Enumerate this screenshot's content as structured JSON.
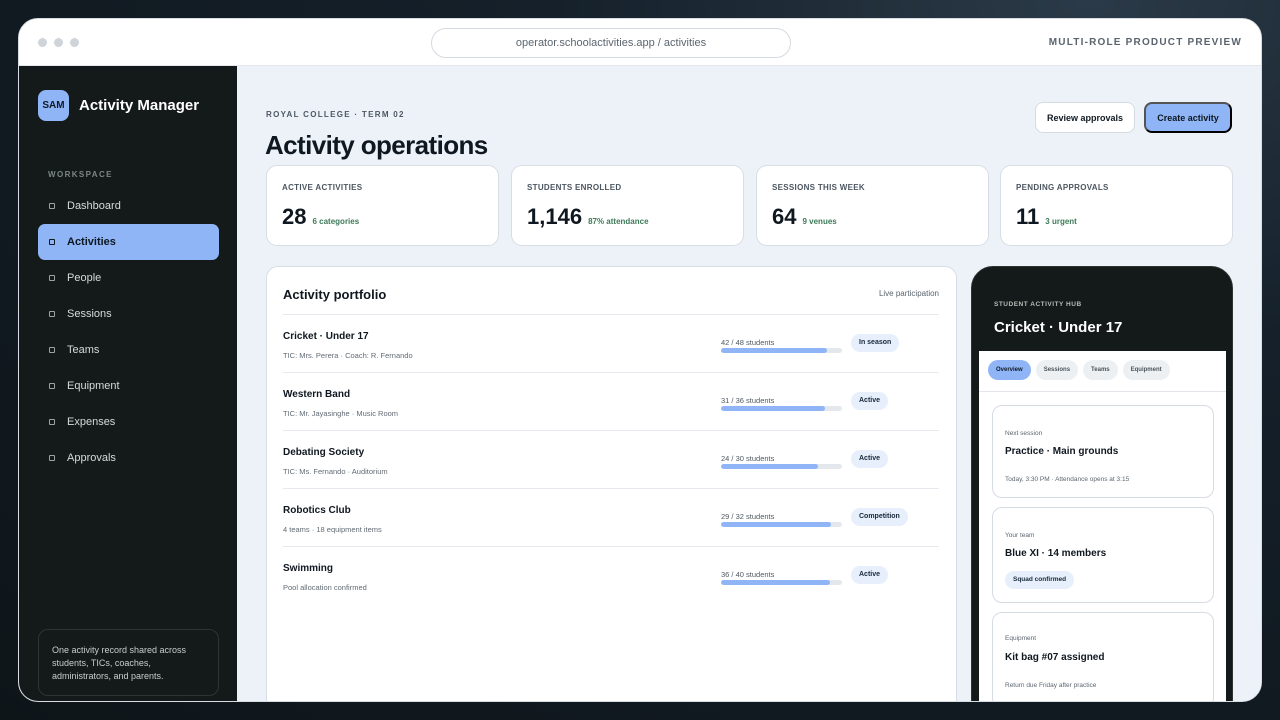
{
  "browser": {
    "url": "operator.schoolactivities.app / activities",
    "preview_label": "MULTI-ROLE PRODUCT PREVIEW"
  },
  "sidebar": {
    "logo_text": "SAM",
    "brand": "Activity Manager",
    "section_label": "WORKSPACE",
    "items": [
      {
        "label": "Dashboard",
        "active": false
      },
      {
        "label": "Activities",
        "active": true
      },
      {
        "label": "People",
        "active": false
      },
      {
        "label": "Sessions",
        "active": false
      },
      {
        "label": "Teams",
        "active": false
      },
      {
        "label": "Equipment",
        "active": false
      },
      {
        "label": "Expenses",
        "active": false
      },
      {
        "label": "Approvals",
        "active": false
      }
    ],
    "note": "One activity record shared across students, TICs, coaches, administrators, and parents."
  },
  "header": {
    "eyebrow": "ROYAL COLLEGE · TERM 02",
    "title": "Activity operations",
    "review_button": "Review approvals",
    "create_button": "Create activity"
  },
  "stats": [
    {
      "label": "ACTIVE ACTIVITIES",
      "value": "28",
      "sub": "6 categories"
    },
    {
      "label": "STUDENTS ENROLLED",
      "value": "1,146",
      "sub": "87% attendance"
    },
    {
      "label": "SESSIONS THIS WEEK",
      "value": "64",
      "sub": "9 venues"
    },
    {
      "label": "PENDING APPROVALS",
      "value": "11",
      "sub": "3 urgent"
    }
  ],
  "portfolio": {
    "title": "Activity portfolio",
    "meta": "Live participation",
    "rows": [
      {
        "name": "Cricket · Under 17",
        "desc": "TIC: Mrs. Perera · Coach: R. Fernando",
        "count": "42 / 48 students",
        "enrolled": 42,
        "capacity": 48,
        "status": "In season"
      },
      {
        "name": "Western Band",
        "desc": "TIC: Mr. Jayasinghe · Music Room",
        "count": "31 / 36 students",
        "enrolled": 31,
        "capacity": 36,
        "status": "Active"
      },
      {
        "name": "Debating Society",
        "desc": "TIC: Ms. Fernando · Auditorium",
        "count": "24 / 30 students",
        "enrolled": 24,
        "capacity": 30,
        "status": "Active"
      },
      {
        "name": "Robotics Club",
        "desc": "4 teams · 18 equipment items",
        "count": "29 / 32 students",
        "enrolled": 29,
        "capacity": 32,
        "status": "Competition"
      },
      {
        "name": "Swimming",
        "desc": "Pool allocation confirmed",
        "count": "36 / 40 students",
        "enrolled": 36,
        "capacity": 40,
        "status": "Active"
      }
    ]
  },
  "phone": {
    "eyebrow": "STUDENT ACTIVITY HUB",
    "title": "Cricket · Under 17",
    "tabs": [
      {
        "label": "Overview",
        "active": true
      },
      {
        "label": "Sessions",
        "active": false
      },
      {
        "label": "Teams",
        "active": false
      },
      {
        "label": "Equipment",
        "active": false
      }
    ],
    "cards": {
      "next": {
        "label": "Next session",
        "title": "Practice · Main grounds",
        "sub": "Today, 3:30 PM · Attendance opens at 3:15"
      },
      "team": {
        "label": "Your team",
        "title": "Blue XI · 14 members",
        "pill": "Squad confirmed"
      },
      "equipment": {
        "label": "Equipment",
        "title": "Kit bag #07 assigned",
        "sub": "Return due Friday after practice"
      }
    }
  },
  "colors": {
    "accent": "#8fb5f7",
    "sidebar_bg": "#131a19",
    "positive_text": "#3d7a58"
  }
}
